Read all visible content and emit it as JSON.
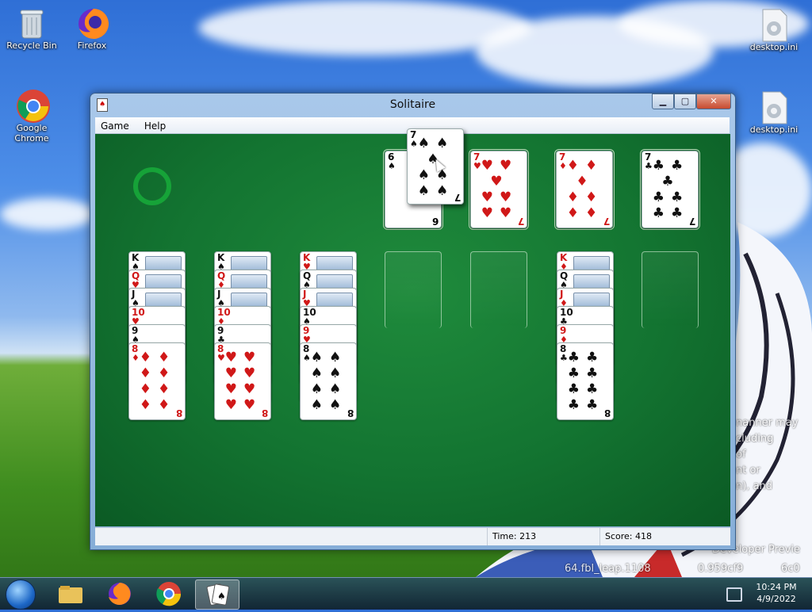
{
  "desktop": {
    "icons": [
      {
        "label": "Recycle Bin",
        "icon": "recycle-bin-icon"
      },
      {
        "label": "Firefox",
        "icon": "firefox-icon"
      },
      {
        "label": "Google Chrome",
        "icon": "chrome-icon"
      },
      {
        "label": "desktop.ini",
        "icon": "settings-file-icon"
      },
      {
        "label": "desktop.ini",
        "icon": "settings-file-icon"
      }
    ],
    "watermark_lines": [
      "nanner may",
      "cluding",
      "of",
      "nt or",
      "n), and",
      "Developer Previe",
      "64.fbl_leap.1108",
      "0.959cf9",
      "6c0"
    ]
  },
  "window": {
    "title": "Solitaire",
    "menu": [
      "Game",
      "Help"
    ],
    "controls": [
      "minimize",
      "maximize",
      "close"
    ]
  },
  "game": {
    "dragged_card": {
      "rank": "7",
      "suit": "♠",
      "color": "black"
    },
    "foundations": [
      {
        "rank": "6",
        "suit": "♠",
        "color": "black"
      },
      {
        "rank": "7",
        "suit": "♥",
        "color": "red"
      },
      {
        "rank": "7",
        "suit": "♦",
        "color": "red"
      },
      {
        "rank": "7",
        "suit": "♣",
        "color": "black"
      }
    ],
    "tableau": [
      [
        {
          "rank": "K",
          "suit": "♠"
        },
        {
          "rank": "Q",
          "suit": "♥"
        },
        {
          "rank": "J",
          "suit": "♠"
        },
        {
          "rank": "10",
          "suit": "♥"
        },
        {
          "rank": "9",
          "suit": "♠"
        },
        {
          "rank": "8",
          "suit": "♦"
        }
      ],
      [
        {
          "rank": "K",
          "suit": "♠"
        },
        {
          "rank": "Q",
          "suit": "♦"
        },
        {
          "rank": "J",
          "suit": "♠"
        },
        {
          "rank": "10",
          "suit": "♦"
        },
        {
          "rank": "9",
          "suit": "♣"
        },
        {
          "rank": "8",
          "suit": "♥"
        }
      ],
      [
        {
          "rank": "K",
          "suit": "♥"
        },
        {
          "rank": "Q",
          "suit": "♠"
        },
        {
          "rank": "J",
          "suit": "♥"
        },
        {
          "rank": "10",
          "suit": "♠"
        },
        {
          "rank": "9",
          "suit": "♥"
        },
        {
          "rank": "8",
          "suit": "♠"
        }
      ],
      [],
      [],
      [
        {
          "rank": "K",
          "suit": "♦"
        },
        {
          "rank": "Q",
          "suit": "♠"
        },
        {
          "rank": "J",
          "suit": "♦"
        },
        {
          "rank": "10",
          "suit": "♣"
        },
        {
          "rank": "9",
          "suit": "♦"
        },
        {
          "rank": "8",
          "suit": "♣"
        }
      ],
      []
    ]
  },
  "status": {
    "time_label": "Time:",
    "time_value": "213",
    "score_label": "Score:",
    "score_value": "418"
  },
  "taskbar": {
    "items": [
      "start-orb",
      "file-explorer-icon",
      "firefox-icon",
      "chrome-icon",
      "solitaire-icon"
    ],
    "active": "solitaire-icon",
    "clock_time": "10:24 PM",
    "clock_date": "4/9/2022"
  }
}
